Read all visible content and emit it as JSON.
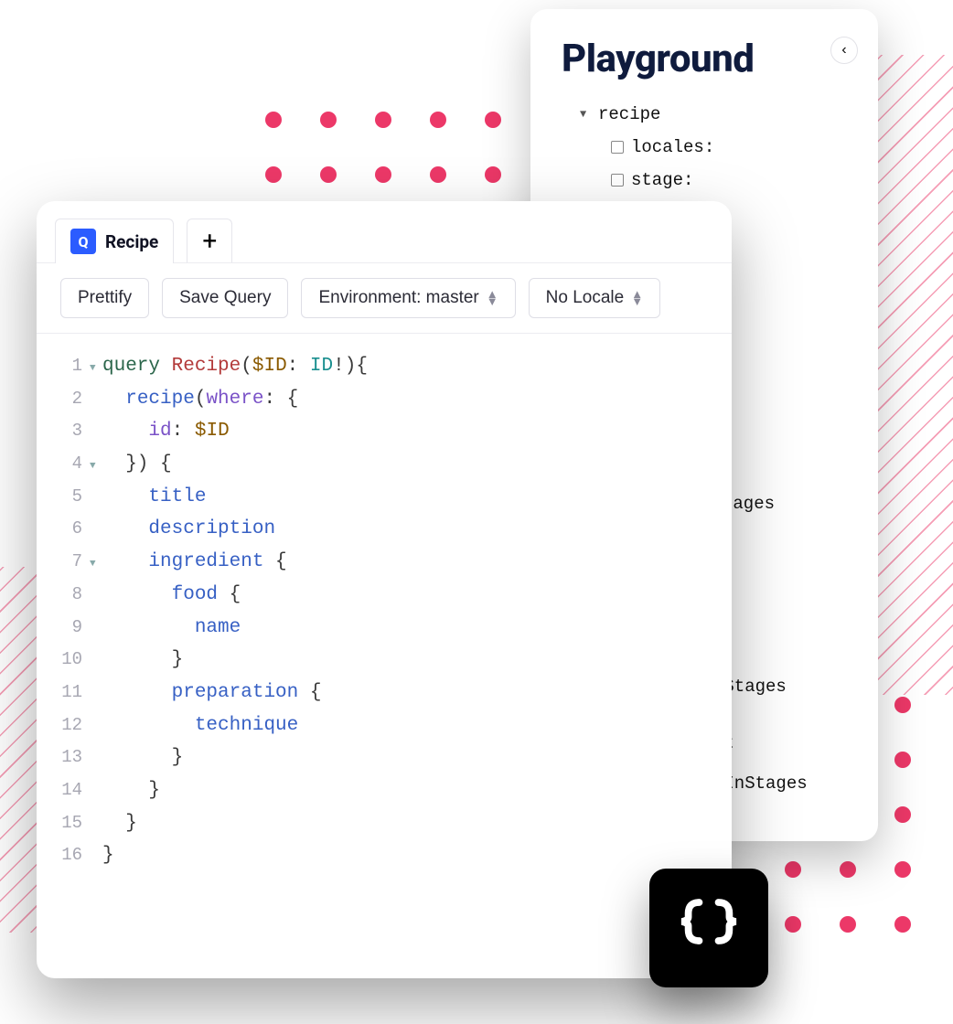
{
  "decor": {
    "dot_color": "#ec3868"
  },
  "playground": {
    "title": "Playground",
    "tree": {
      "root": "recipe",
      "params": [
        {
          "label": "locales:"
        },
        {
          "label": "stage:"
        }
      ]
    },
    "field_fragments": [
      "tages",
      "nStages",
      "At",
      "tInStages"
    ]
  },
  "editor": {
    "tab_badge": "Q",
    "tab_label": "Recipe",
    "new_tab_symbol": "+",
    "toolbar": {
      "prettify": "Prettify",
      "save": "Save Query",
      "env": "Environment: master",
      "locale": "No Locale"
    },
    "lines": [
      {
        "n": 1,
        "fold": true,
        "tokens": [
          [
            "kw",
            "query "
          ],
          [
            "name",
            "Recipe"
          ],
          [
            "pn",
            "("
          ],
          [
            "var",
            "$ID"
          ],
          [
            "pn",
            ": "
          ],
          [
            "ty",
            "ID"
          ],
          [
            "pn",
            "!){"
          ]
        ]
      },
      {
        "n": 2,
        "fold": false,
        "tokens": [
          [
            "pn",
            "  "
          ],
          [
            "fld",
            "recipe"
          ],
          [
            "pn",
            "("
          ],
          [
            "arg",
            "where"
          ],
          [
            "pn",
            ": {"
          ]
        ]
      },
      {
        "n": 3,
        "fold": false,
        "tokens": [
          [
            "pn",
            "    "
          ],
          [
            "arg",
            "id"
          ],
          [
            "pn",
            ": "
          ],
          [
            "var",
            "$ID"
          ]
        ]
      },
      {
        "n": 4,
        "fold": true,
        "tokens": [
          [
            "pn",
            "  }) {"
          ]
        ]
      },
      {
        "n": 5,
        "fold": false,
        "tokens": [
          [
            "pn",
            "    "
          ],
          [
            "fld",
            "title"
          ]
        ]
      },
      {
        "n": 6,
        "fold": false,
        "tokens": [
          [
            "pn",
            "    "
          ],
          [
            "fld",
            "description"
          ]
        ]
      },
      {
        "n": 7,
        "fold": true,
        "tokens": [
          [
            "pn",
            "    "
          ],
          [
            "fld",
            "ingredient"
          ],
          [
            "pn",
            " {"
          ]
        ]
      },
      {
        "n": 8,
        "fold": false,
        "tokens": [
          [
            "pn",
            "      "
          ],
          [
            "fld",
            "food"
          ],
          [
            "pn",
            " {"
          ]
        ]
      },
      {
        "n": 9,
        "fold": false,
        "tokens": [
          [
            "pn",
            "        "
          ],
          [
            "fld",
            "name"
          ]
        ]
      },
      {
        "n": 10,
        "fold": false,
        "tokens": [
          [
            "pn",
            "      }"
          ]
        ]
      },
      {
        "n": 11,
        "fold": false,
        "tokens": [
          [
            "pn",
            "      "
          ],
          [
            "fld",
            "preparation"
          ],
          [
            "pn",
            " {"
          ]
        ]
      },
      {
        "n": 12,
        "fold": false,
        "tokens": [
          [
            "pn",
            "        "
          ],
          [
            "fld",
            "technique"
          ]
        ]
      },
      {
        "n": 13,
        "fold": false,
        "tokens": [
          [
            "pn",
            "      }"
          ]
        ]
      },
      {
        "n": 14,
        "fold": false,
        "tokens": [
          [
            "pn",
            "    }"
          ]
        ]
      },
      {
        "n": 15,
        "fold": false,
        "tokens": [
          [
            "pn",
            "  }"
          ]
        ]
      },
      {
        "n": 16,
        "fold": false,
        "tokens": [
          [
            "pn",
            "}"
          ]
        ]
      }
    ]
  },
  "curly": "{ }"
}
